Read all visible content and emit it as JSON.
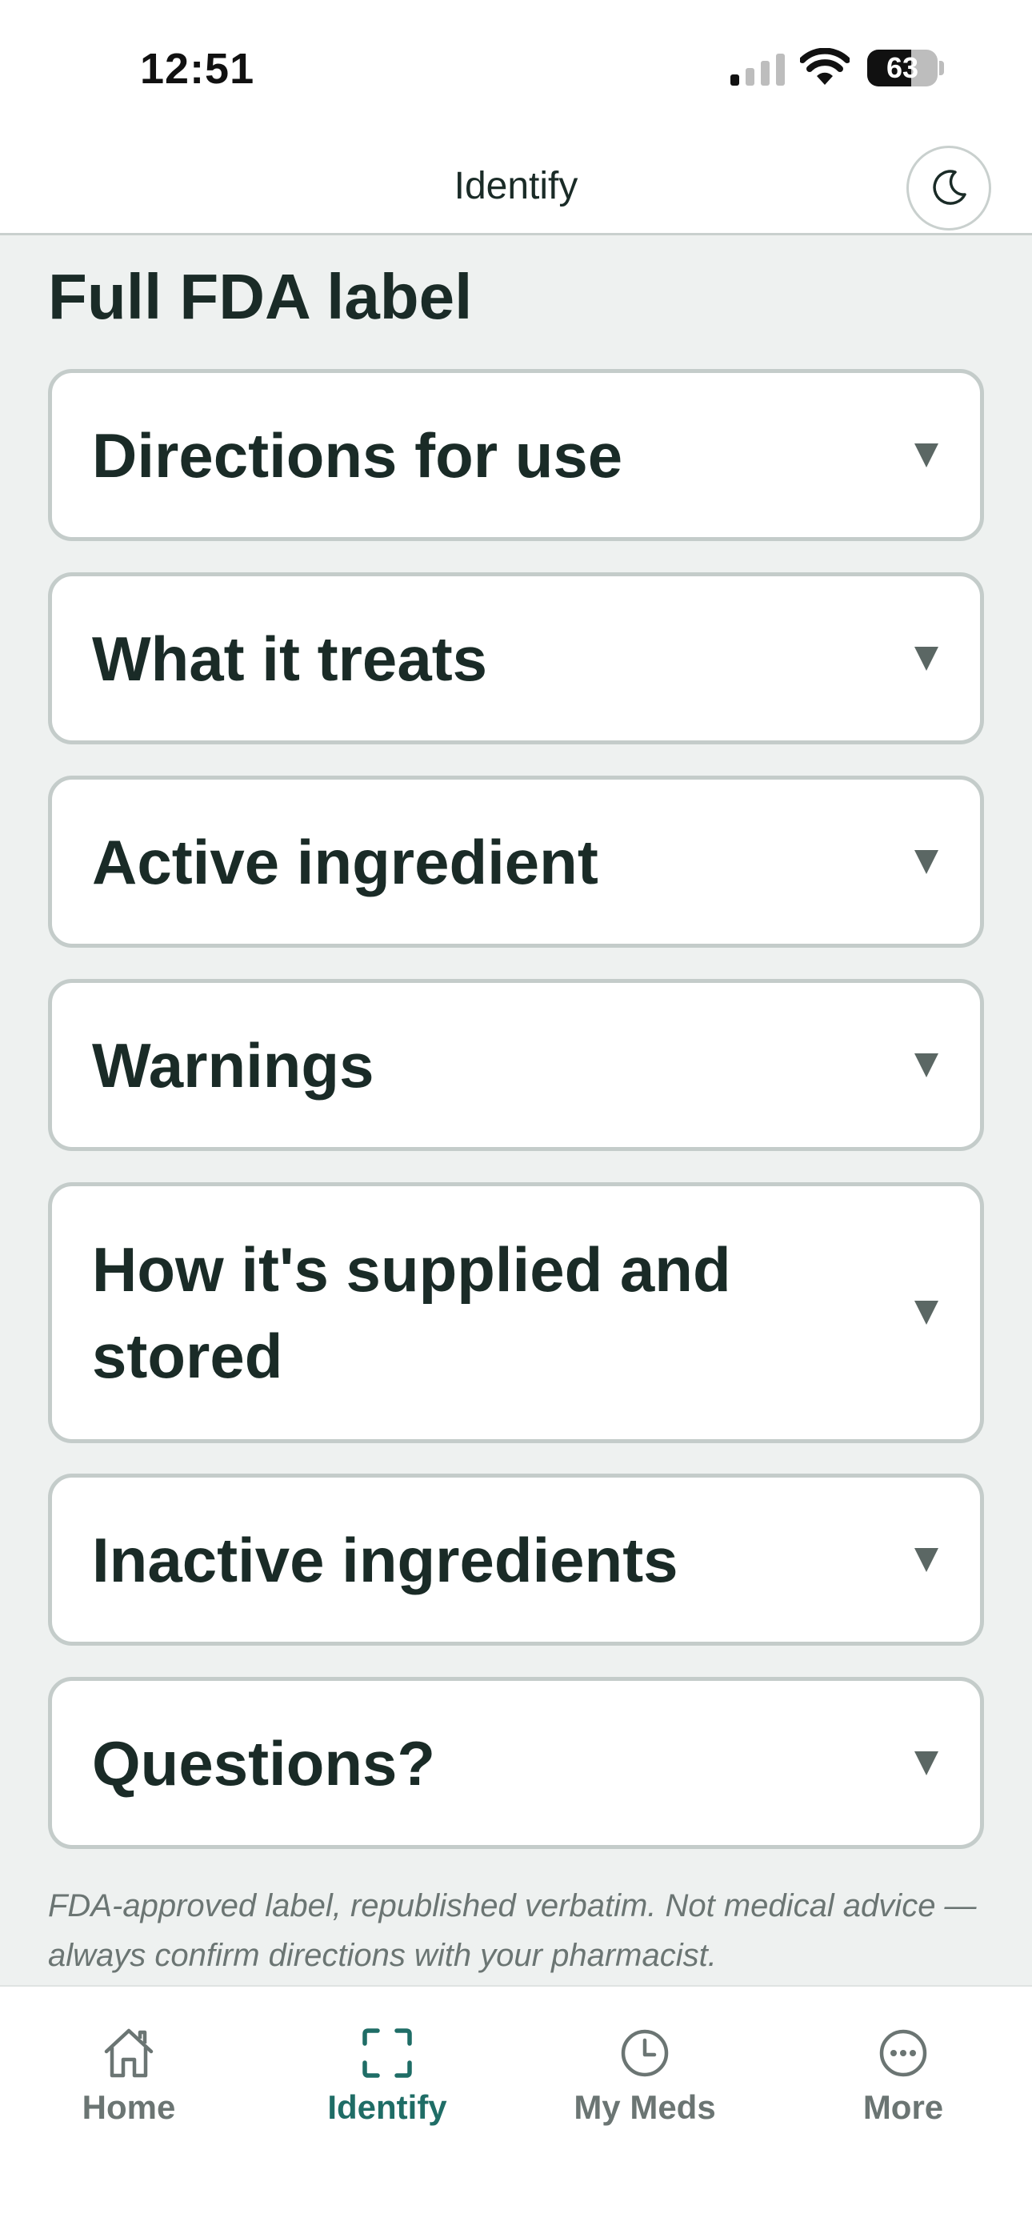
{
  "status_bar": {
    "time": "12:51",
    "battery_percent": 63,
    "battery_label": "63"
  },
  "header": {
    "title": "Identify",
    "theme_toggle_icon": "moon-icon"
  },
  "section": {
    "title": "Full FDA label"
  },
  "accordions": [
    {
      "label": "Directions for use"
    },
    {
      "label": "What it treats"
    },
    {
      "label": "Active ingredient"
    },
    {
      "label": "Warnings"
    },
    {
      "label": "How it's supplied and stored"
    },
    {
      "label": "Inactive ingredients"
    },
    {
      "label": "Questions?"
    }
  ],
  "disclaimer": "FDA-approved label, republished verbatim. Not medical advice — always confirm directions with your pharmacist.",
  "bottom_nav": {
    "items": [
      {
        "label": "Home",
        "icon": "home-icon",
        "active": false
      },
      {
        "label": "Identify",
        "icon": "scan-icon",
        "active": true
      },
      {
        "label": "My Meds",
        "icon": "clock-icon",
        "active": false
      },
      {
        "label": "More",
        "icon": "more-icon",
        "active": false
      }
    ]
  },
  "colors": {
    "accent": "#1f6d66",
    "text": "#1a2b27",
    "background": "#eef1f0",
    "border": "#c4ccca",
    "muted": "#6b7573"
  }
}
